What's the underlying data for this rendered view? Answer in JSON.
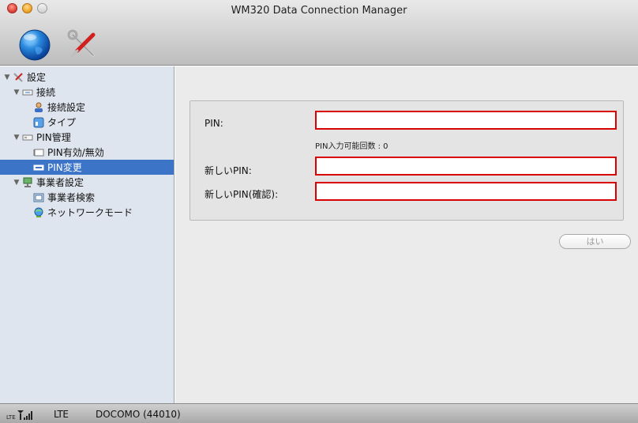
{
  "window": {
    "title": "WM320 Data Connection Manager"
  },
  "toolbar": {
    "items": [
      {
        "icon": "globe-icon"
      },
      {
        "icon": "tools-icon"
      }
    ]
  },
  "sidebar": {
    "items": [
      {
        "label": "設定",
        "icon": "tools-icon",
        "level": 0,
        "expanded": true
      },
      {
        "label": "接続",
        "icon": "connection-icon",
        "level": 1,
        "expanded": true
      },
      {
        "label": "接続設定",
        "icon": "user-icon",
        "level": 2
      },
      {
        "label": "タイプ",
        "icon": "type-icon",
        "level": 2
      },
      {
        "label": "PIN管理",
        "icon": "pin-card-icon",
        "level": 1,
        "expanded": true
      },
      {
        "label": "PIN有効/無効",
        "icon": "pin-card-icon",
        "level": 2
      },
      {
        "label": "PIN変更",
        "icon": "pin-card-icon",
        "level": 2,
        "selected": true
      },
      {
        "label": "事業者設定",
        "icon": "operator-icon",
        "level": 1,
        "expanded": true
      },
      {
        "label": "事業者検索",
        "icon": "search-box-icon",
        "level": 2
      },
      {
        "label": "ネットワークモード",
        "icon": "network-icon",
        "level": 2
      }
    ]
  },
  "form": {
    "pin_label": "PIN:",
    "pin_value": "",
    "remaining_text": "PIN入力可能回数 : 0",
    "new_pin_label": "新しいPIN:",
    "new_pin_value": "",
    "confirm_pin_label": "新しいPIN(確認):",
    "confirm_pin_value": "",
    "ok_button": "はい"
  },
  "status": {
    "network_type": "LTE",
    "carrier": "DOCOMO (44010)"
  },
  "colors": {
    "selection": "#3c75c8",
    "input_border": "#d80000",
    "sidebar_bg": "#dfe5ee"
  }
}
